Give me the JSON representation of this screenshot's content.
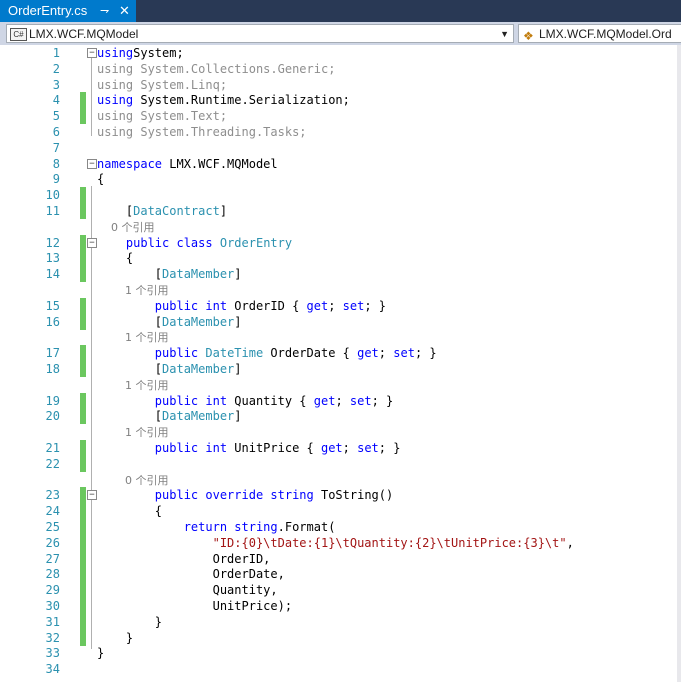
{
  "tab": {
    "title": "OrderEntry.cs",
    "pin": "⇁",
    "close": "✕"
  },
  "nav": {
    "project": "LMX.WCF.MQModel",
    "project_icon": "C#",
    "member": "LMX.WCF.MQModel.Ord",
    "dropdown": "▼"
  },
  "colors": {
    "keyword": "#0000ff",
    "type": "#2b91af",
    "string": "#a31515",
    "change_bar": "#6bc75f"
  },
  "lines": [
    {
      "n": "1",
      "t": [
        [
          "kw",
          "using"
        ],
        [
          "",
          "System;"
        ]
      ],
      "fold": "−",
      "chg": false
    },
    {
      "n": "2",
      "t": [
        [
          "gray",
          "using System.Collections.Generic;"
        ]
      ],
      "chg": false
    },
    {
      "n": "3",
      "t": [
        [
          "gray",
          "using System.Linq;"
        ]
      ],
      "chg": false
    },
    {
      "n": "4",
      "t": [
        [
          "kw",
          "using"
        ],
        [
          "",
          " System.Runtime.Serialization;"
        ]
      ],
      "chg": true
    },
    {
      "n": "5",
      "t": [
        [
          "gray",
          "using System.Text;"
        ]
      ],
      "chg": true
    },
    {
      "n": "6",
      "t": [
        [
          "gray",
          "using System.Threading.Tasks;"
        ]
      ],
      "chg": false
    },
    {
      "n": "7",
      "t": [
        [
          "",
          ""
        ]
      ],
      "chg": false
    },
    {
      "n": "8",
      "t": [
        [
          "kw",
          "namespace"
        ],
        [
          "",
          " LMX.WCF.MQModel"
        ]
      ],
      "fold": "−",
      "chg": false
    },
    {
      "n": "9",
      "t": [
        [
          "",
          "{"
        ]
      ],
      "chg": false
    },
    {
      "n": "10",
      "t": [
        [
          "",
          ""
        ]
      ],
      "chg": true
    },
    {
      "n": "11",
      "t": [
        [
          "",
          "    ["
        ],
        [
          "ty",
          "DataContract"
        ],
        [
          "",
          "]"
        ]
      ],
      "chg": true
    },
    {
      "n": "",
      "t": [
        [
          "lens",
          "    0 个引用"
        ]
      ],
      "chg": false
    },
    {
      "n": "12",
      "t": [
        [
          "",
          "    "
        ],
        [
          "kw",
          "public class"
        ],
        [
          "",
          " "
        ],
        [
          "ty",
          "OrderEntry"
        ]
      ],
      "fold": "−",
      "chg": true
    },
    {
      "n": "13",
      "t": [
        [
          "",
          "    {"
        ]
      ],
      "chg": true
    },
    {
      "n": "14",
      "t": [
        [
          "",
          "        ["
        ],
        [
          "ty",
          "DataMember"
        ],
        [
          "",
          "]"
        ]
      ],
      "chg": true
    },
    {
      "n": "",
      "t": [
        [
          "lens",
          "        1 个引用"
        ]
      ],
      "chg": false
    },
    {
      "n": "15",
      "t": [
        [
          "",
          "        "
        ],
        [
          "kw",
          "public int"
        ],
        [
          "",
          " OrderID { "
        ],
        [
          "kw",
          "get"
        ],
        [
          "",
          "; "
        ],
        [
          "kw",
          "set"
        ],
        [
          "",
          "; }"
        ]
      ],
      "chg": true
    },
    {
      "n": "16",
      "t": [
        [
          "",
          "        ["
        ],
        [
          "ty",
          "DataMember"
        ],
        [
          "",
          "]"
        ]
      ],
      "chg": true
    },
    {
      "n": "",
      "t": [
        [
          "lens",
          "        1 个引用"
        ]
      ],
      "chg": false
    },
    {
      "n": "17",
      "t": [
        [
          "",
          "        "
        ],
        [
          "kw",
          "public"
        ],
        [
          "",
          " "
        ],
        [
          "ty",
          "DateTime"
        ],
        [
          "",
          " OrderDate { "
        ],
        [
          "kw",
          "get"
        ],
        [
          "",
          "; "
        ],
        [
          "kw",
          "set"
        ],
        [
          "",
          "; }"
        ]
      ],
      "chg": true
    },
    {
      "n": "18",
      "t": [
        [
          "",
          "        ["
        ],
        [
          "ty",
          "DataMember"
        ],
        [
          "",
          "]"
        ]
      ],
      "chg": true
    },
    {
      "n": "",
      "t": [
        [
          "lens",
          "        1 个引用"
        ]
      ],
      "chg": false
    },
    {
      "n": "19",
      "t": [
        [
          "",
          "        "
        ],
        [
          "kw",
          "public int"
        ],
        [
          "",
          " Quantity { "
        ],
        [
          "kw",
          "get"
        ],
        [
          "",
          "; "
        ],
        [
          "kw",
          "set"
        ],
        [
          "",
          "; }"
        ]
      ],
      "chg": true
    },
    {
      "n": "20",
      "t": [
        [
          "",
          "        ["
        ],
        [
          "ty",
          "DataMember"
        ],
        [
          "",
          "]"
        ]
      ],
      "chg": true
    },
    {
      "n": "",
      "t": [
        [
          "lens",
          "        1 个引用"
        ]
      ],
      "chg": false
    },
    {
      "n": "21",
      "t": [
        [
          "",
          "        "
        ],
        [
          "kw",
          "public int"
        ],
        [
          "",
          " UnitPrice { "
        ],
        [
          "kw",
          "get"
        ],
        [
          "",
          "; "
        ],
        [
          "kw",
          "set"
        ],
        [
          "",
          "; }"
        ]
      ],
      "chg": true
    },
    {
      "n": "22",
      "t": [
        [
          "",
          ""
        ]
      ],
      "chg": true
    },
    {
      "n": "",
      "t": [
        [
          "lens",
          "        0 个引用"
        ]
      ],
      "chg": false
    },
    {
      "n": "23",
      "t": [
        [
          "",
          "        "
        ],
        [
          "kw",
          "public override string"
        ],
        [
          "",
          " ToString()"
        ]
      ],
      "fold": "−",
      "chg": true
    },
    {
      "n": "24",
      "t": [
        [
          "",
          "        {"
        ]
      ],
      "chg": true
    },
    {
      "n": "25",
      "t": [
        [
          "",
          "            "
        ],
        [
          "kw",
          "return string"
        ],
        [
          "",
          ".Format("
        ]
      ],
      "chg": true
    },
    {
      "n": "26",
      "t": [
        [
          "",
          "                "
        ],
        [
          "st",
          "\"ID:{0}\\tDate:{1}\\tQuantity:{2}\\tUnitPrice:{3}\\t\""
        ],
        [
          "",
          ","
        ]
      ],
      "chg": true
    },
    {
      "n": "27",
      "t": [
        [
          "",
          "                OrderID,"
        ]
      ],
      "chg": true
    },
    {
      "n": "28",
      "t": [
        [
          "",
          "                OrderDate,"
        ]
      ],
      "chg": true
    },
    {
      "n": "29",
      "t": [
        [
          "",
          "                Quantity,"
        ]
      ],
      "chg": true
    },
    {
      "n": "30",
      "t": [
        [
          "",
          "                UnitPrice);"
        ]
      ],
      "chg": true
    },
    {
      "n": "31",
      "t": [
        [
          "",
          "        }"
        ]
      ],
      "chg": true
    },
    {
      "n": "32",
      "t": [
        [
          "",
          "    }"
        ]
      ],
      "chg": true
    },
    {
      "n": "33",
      "t": [
        [
          "",
          "}"
        ]
      ],
      "chg": false
    },
    {
      "n": "34",
      "t": [
        [
          "",
          ""
        ]
      ],
      "chg": false
    }
  ]
}
